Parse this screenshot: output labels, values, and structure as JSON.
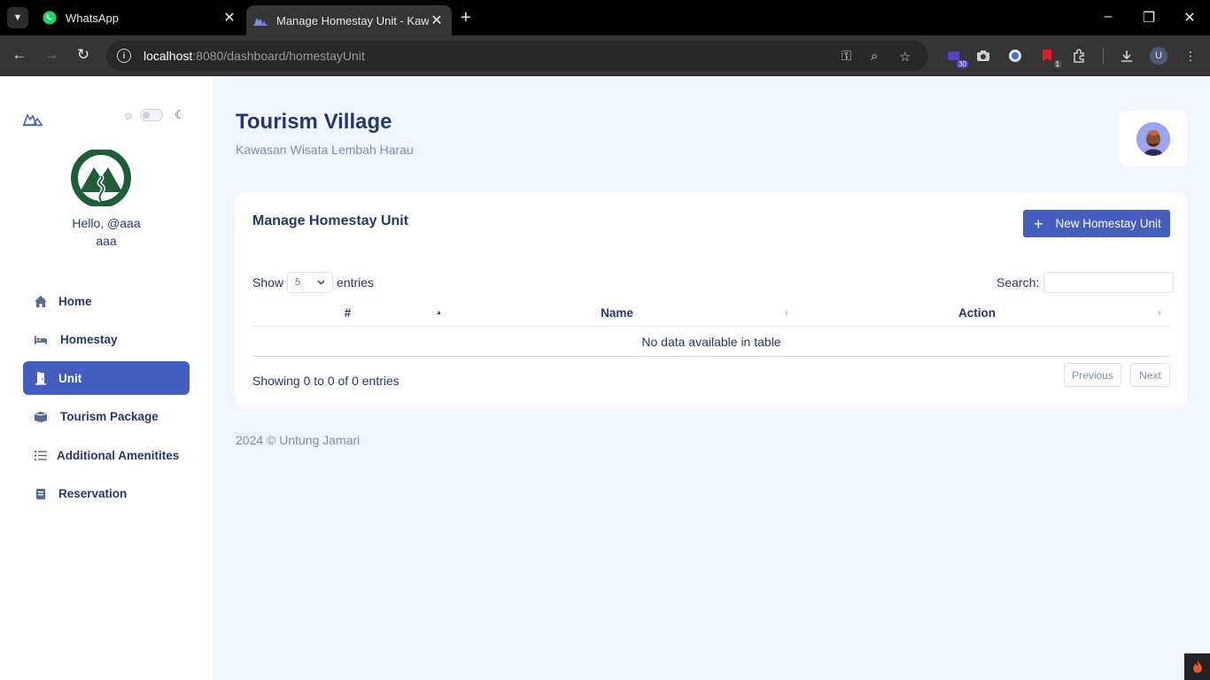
{
  "browser": {
    "tabs": [
      {
        "title": "WhatsApp",
        "icon": "whatsapp-icon"
      },
      {
        "title": "Manage Homestay Unit - Kawasan Wisata Lembah Harau",
        "icon": "village-logo-icon"
      }
    ],
    "url_host": "localhost",
    "url_rest": ":8080/dashboard/homestayUnit",
    "extension_badges": {
      "first": "30",
      "second": "1"
    },
    "profile_initial": "U"
  },
  "sidebar": {
    "greeting": "Hello, @aaa",
    "username": "aaa",
    "items": [
      {
        "label": "Home",
        "icon": "home-icon",
        "active": false
      },
      {
        "label": "Homestay",
        "icon": "bed-icon",
        "active": false
      },
      {
        "label": "Unit",
        "icon": "door-icon",
        "active": true
      },
      {
        "label": "Tourism Package",
        "icon": "box-icon",
        "active": false
      },
      {
        "label": "Additional Amenitites",
        "icon": "list-icon",
        "active": false
      },
      {
        "label": "Reservation",
        "icon": "book-icon",
        "active": false
      }
    ]
  },
  "header": {
    "title": "Tourism Village",
    "subtitle": "Kawasan Wisata Lembah Harau"
  },
  "card": {
    "title": "Manage Homestay Unit",
    "new_button": "New Homestay Unit",
    "length_prefix": "Show",
    "length_value": "5",
    "length_suffix": "entries",
    "search_label": "Search:",
    "search_value": "",
    "columns": [
      "#",
      "Name",
      "Action"
    ],
    "empty_text": "No data available in table",
    "info": "Showing 0 to 0 of 0 entries",
    "prev": "Previous",
    "next": "Next"
  },
  "footer": "2024 © Untung Jamari",
  "colors": {
    "primary": "#435ebe",
    "text": "#25396f",
    "muted": "#7c8db5",
    "background": "#f2f7ff",
    "brand_green": "#1f5c38"
  }
}
